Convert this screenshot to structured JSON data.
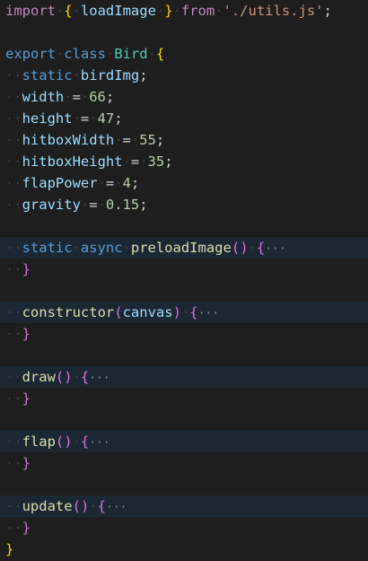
{
  "editor": {
    "line1": {
      "kw": "import",
      "lb": "{",
      "name": "loadImage",
      "rb": "}",
      "from": "from",
      "path": "'./utils.js'",
      "semi": ";"
    },
    "line3": {
      "kw": "export",
      "kw2": "class",
      "name": "Bird",
      "lb": "{"
    },
    "line4": {
      "kw": "static",
      "name": "birdImg",
      "semi": ";"
    },
    "line5": {
      "name": "width",
      "eq": "=",
      "val": "66",
      "semi": ";"
    },
    "line6": {
      "name": "height",
      "eq": "=",
      "val": "47",
      "semi": ";"
    },
    "line7": {
      "name": "hitboxWidth",
      "eq": "=",
      "val": "55",
      "semi": ";"
    },
    "line8": {
      "name": "hitboxHeight",
      "eq": "=",
      "val": "35",
      "semi": ";"
    },
    "line9": {
      "name": "flapPower",
      "eq": "=",
      "val": "4",
      "semi": ";"
    },
    "line10": {
      "name": "gravity",
      "eq": "=",
      "val": "0.15",
      "semi": ";"
    },
    "line12": {
      "kw": "static",
      "kw2": "async",
      "name": "preloadImage",
      "lp": "(",
      "rp": ")",
      "lb": "{",
      "ell": "···"
    },
    "line13": {
      "rb": "}"
    },
    "line15": {
      "name": "constructor",
      "lp": "(",
      "arg": "canvas",
      "rp": ")",
      "lb": "{",
      "ell": "···"
    },
    "line16": {
      "rb": "}"
    },
    "line18": {
      "name": "draw",
      "lp": "(",
      "rp": ")",
      "lb": "{",
      "ell": "···"
    },
    "line19": {
      "rb": "}"
    },
    "line21": {
      "name": "flap",
      "lp": "(",
      "rp": ")",
      "lb": "{",
      "ell": "···"
    },
    "line22": {
      "rb": "}"
    },
    "line24": {
      "name": "update",
      "lp": "(",
      "rp": ")",
      "lb": "{",
      "ell": "···"
    },
    "line25": {
      "rb": "}"
    },
    "line26": {
      "rb": "}"
    }
  }
}
